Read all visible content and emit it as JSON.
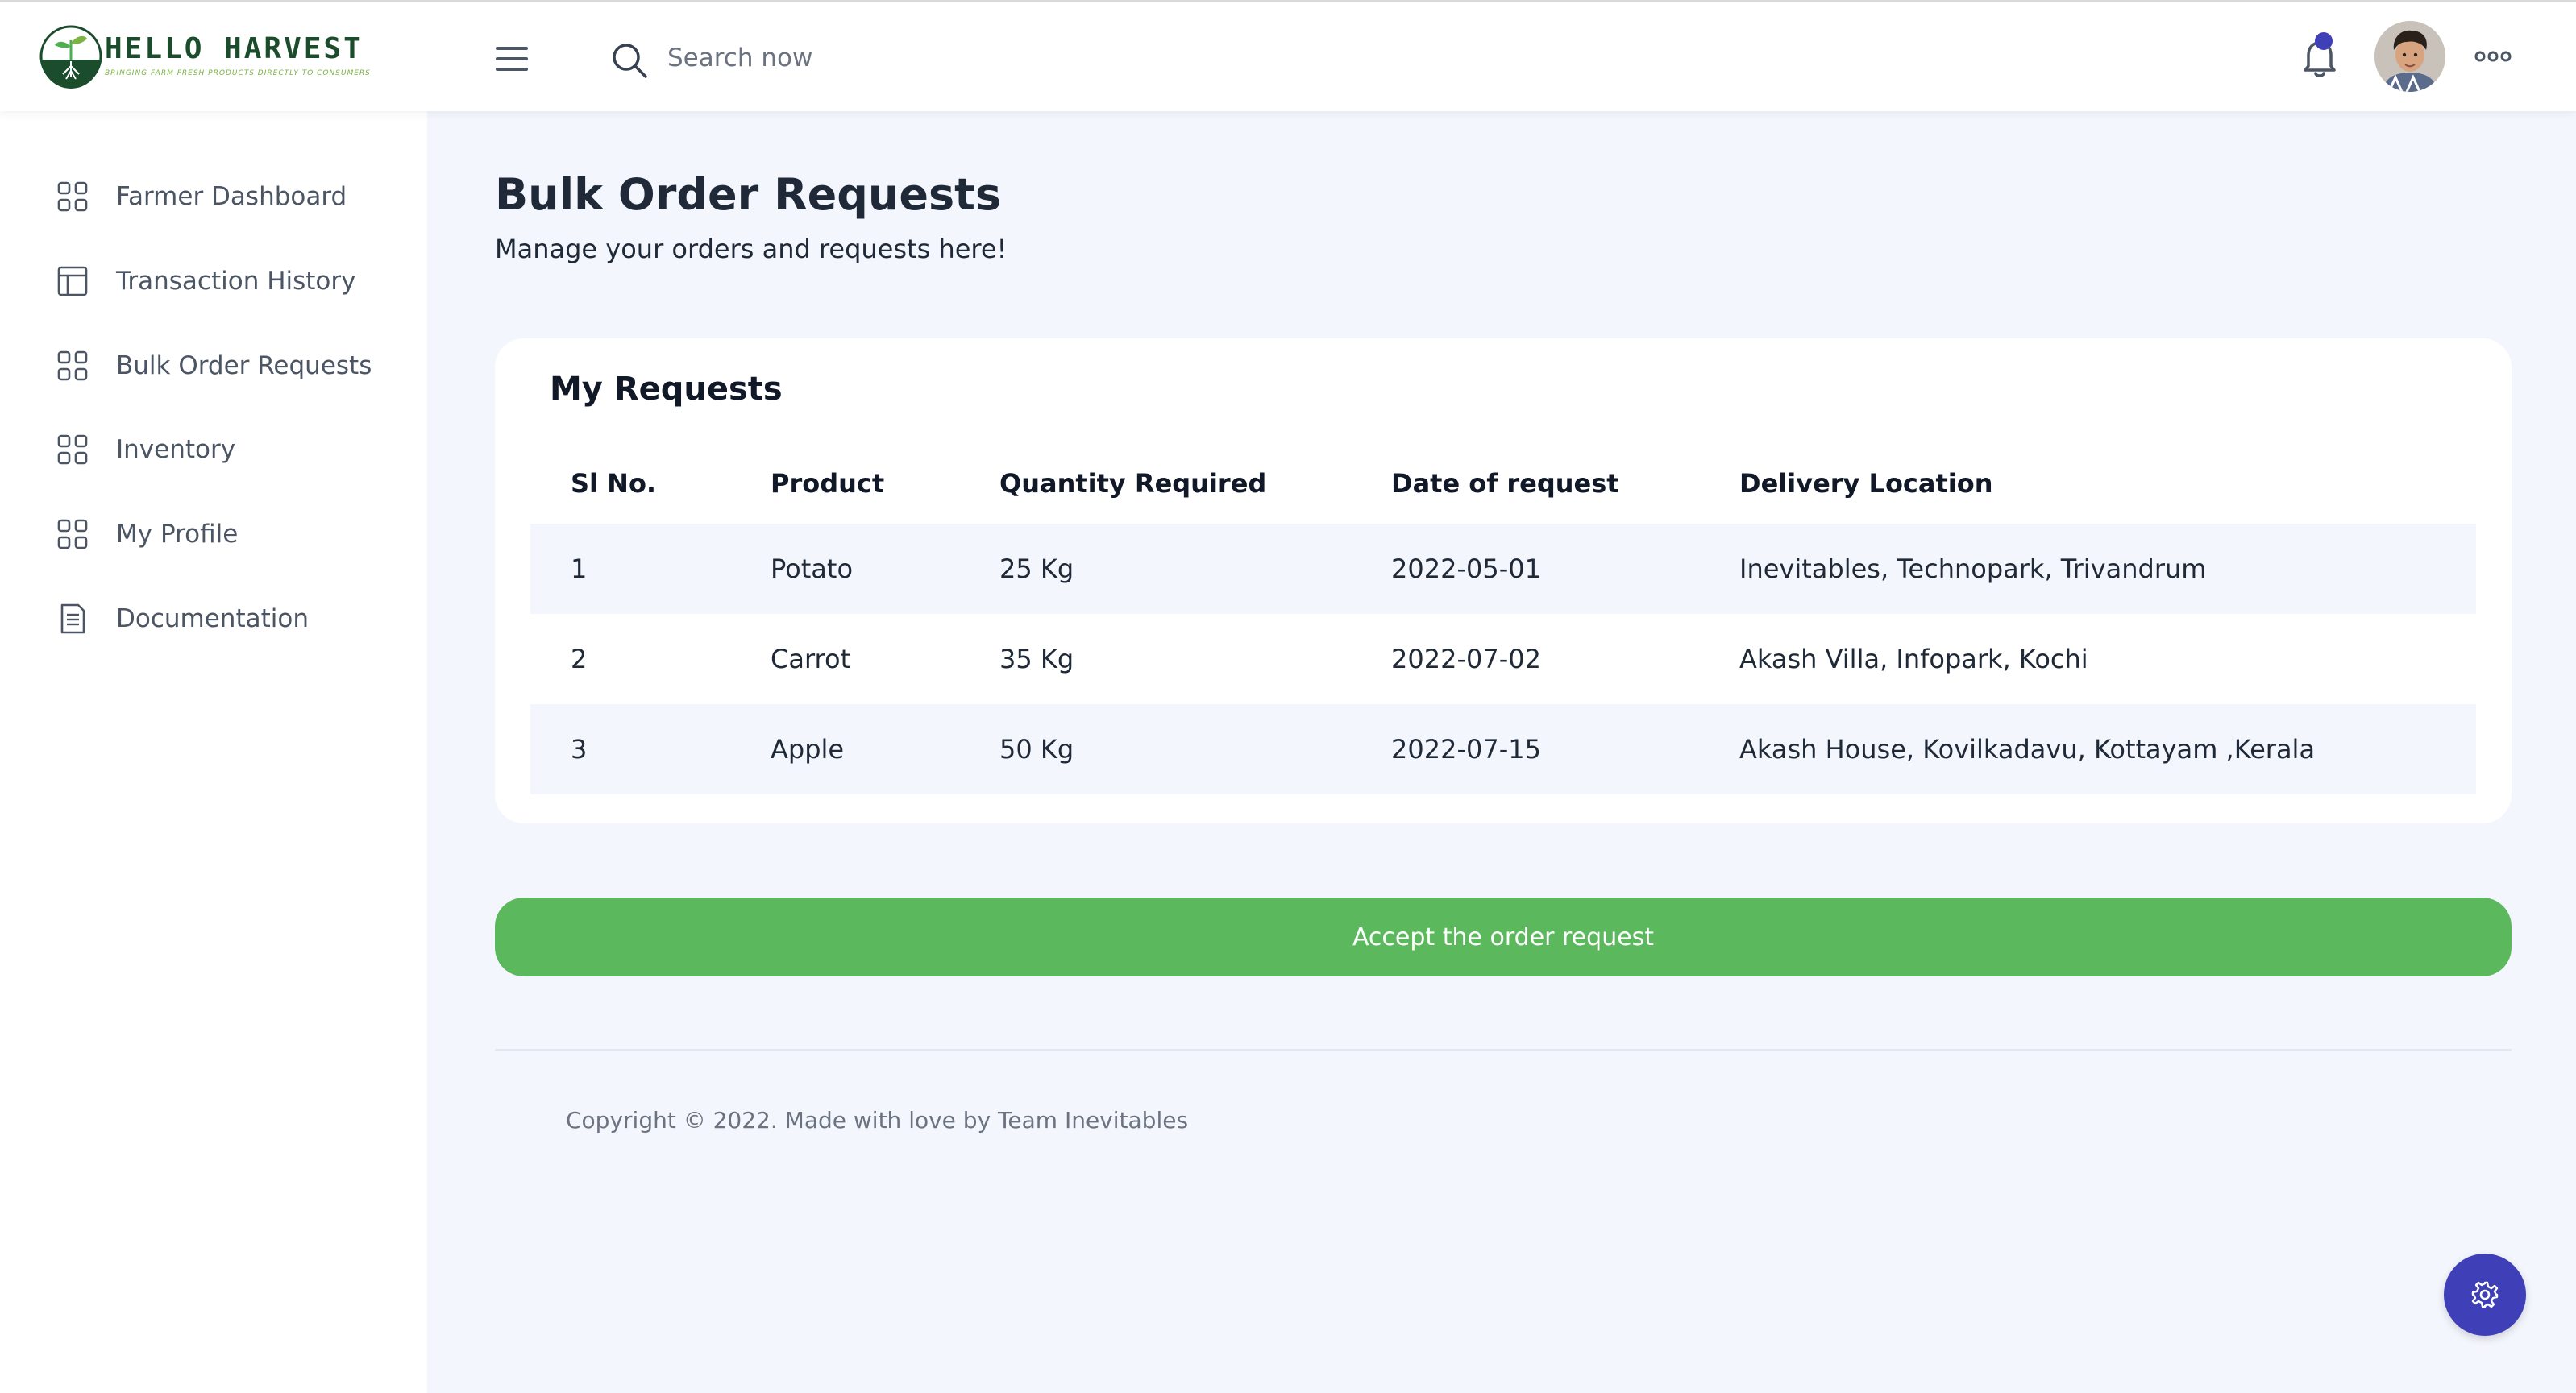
{
  "brand": {
    "name": "HELLO HARVEST",
    "tagline": "BRINGING FARM FRESH PRODUCTS DIRECTLY TO CONSUMERS",
    "logo_icon": "sprout-icon",
    "primary_color": "#1b4d2c",
    "accent_color": "#7cb342"
  },
  "header": {
    "menu_icon": "hamburger-icon",
    "search": {
      "placeholder": "Search now",
      "value": "",
      "icon": "search-icon"
    },
    "notification_icon": "bell-icon",
    "notification_dot_color": "#3f3fb7",
    "avatar_icon": "user-avatar",
    "more_icon": "more-dots-icon"
  },
  "sidebar": {
    "items": [
      {
        "label": "Farmer Dashboard",
        "icon": "grid-icon"
      },
      {
        "label": "Transaction History",
        "icon": "layout-icon"
      },
      {
        "label": "Bulk Order Requests",
        "icon": "grid-icon"
      },
      {
        "label": "Inventory",
        "icon": "grid-icon"
      },
      {
        "label": "My Profile",
        "icon": "grid-icon"
      },
      {
        "label": "Documentation",
        "icon": "document-icon"
      }
    ]
  },
  "main": {
    "title": "Bulk Order Requests",
    "subtitle": "Manage your orders and requests here!",
    "card": {
      "title": "My Requests",
      "columns": [
        "Sl No.",
        "Product",
        "Quantity Required",
        "Date of request",
        "Delivery Location"
      ],
      "rows": [
        [
          "1",
          "Potato",
          "25 Kg",
          "2022-05-01",
          "Inevitables, Technopark, Trivandrum"
        ],
        [
          "2",
          "Carrot",
          "35 Kg",
          "2022-07-02",
          "Akash Villa, Infopark, Kochi"
        ],
        [
          "3",
          "Apple",
          "50 Kg",
          "2022-07-15",
          "Akash House, Kovilkadavu, Kottayam ,Kerala"
        ]
      ]
    },
    "accept_button": {
      "label": "Accept the order request",
      "color": "#5cb85c"
    }
  },
  "footer": {
    "copyright": "Copyright © 2022. Made with love by Team Inevitables"
  },
  "settings_fab": {
    "icon": "gear-icon",
    "color": "#3f3fb7"
  }
}
